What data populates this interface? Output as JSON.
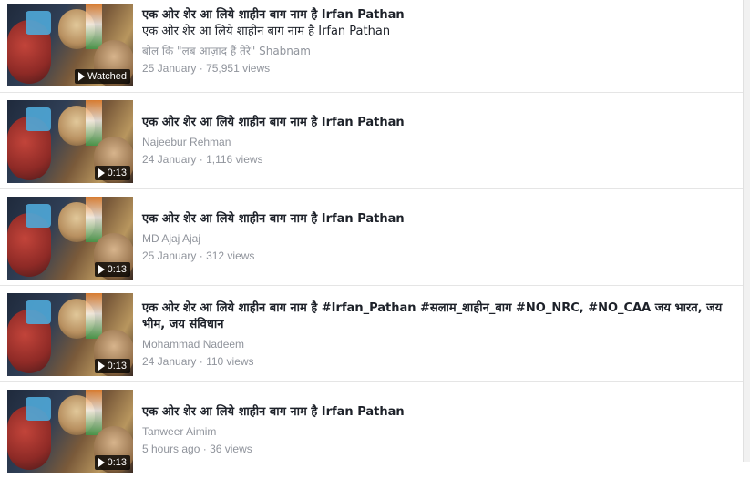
{
  "videos": [
    {
      "title": "एक ओर शेर आ लिये शाहीन बाग नाम है Irfan Pathan",
      "subtitle": "एक ओर शेर आ लिये शाहीन बाग नाम है Irfan Pathan",
      "author": "बोल कि \"लब आज़ाद हैं तेरे\" Shabnam",
      "date": "25 January",
      "separator": "·",
      "views": "75,951 views",
      "badge": "Watched"
    },
    {
      "title": "एक ओर शेर आ लिये शाहीन बाग नाम है Irfan Pathan",
      "author": "Najeebur Rehman",
      "date": "24 January",
      "separator": "·",
      "views": "1,116 views",
      "badge": "0:13"
    },
    {
      "title": "एक ओर शेर आ लिये शाहीन बाग नाम है Irfan Pathan",
      "author": "MD Ajaj Ajaj",
      "date": "25 January",
      "separator": "·",
      "views": "312 views",
      "badge": "0:13"
    },
    {
      "title": "एक ओर शेर आ लिये शाहीन बाग नाम है #Irfan_Pathan #सलाम_शाहीन_बाग #NO_NRC, #NO_CAA जय भारत, जय भीम, जय संविधान",
      "author": "Mohammad Nadeem",
      "date": "24 January",
      "separator": "·",
      "views": "110 views",
      "badge": "0:13"
    },
    {
      "title": "एक ओर शेर आ लिये शाहीन बाग नाम है Irfan Pathan",
      "author": "Tanweer Aimim",
      "date": "5 hours ago",
      "separator": "·",
      "views": "36 views",
      "badge": "0:13"
    }
  ]
}
